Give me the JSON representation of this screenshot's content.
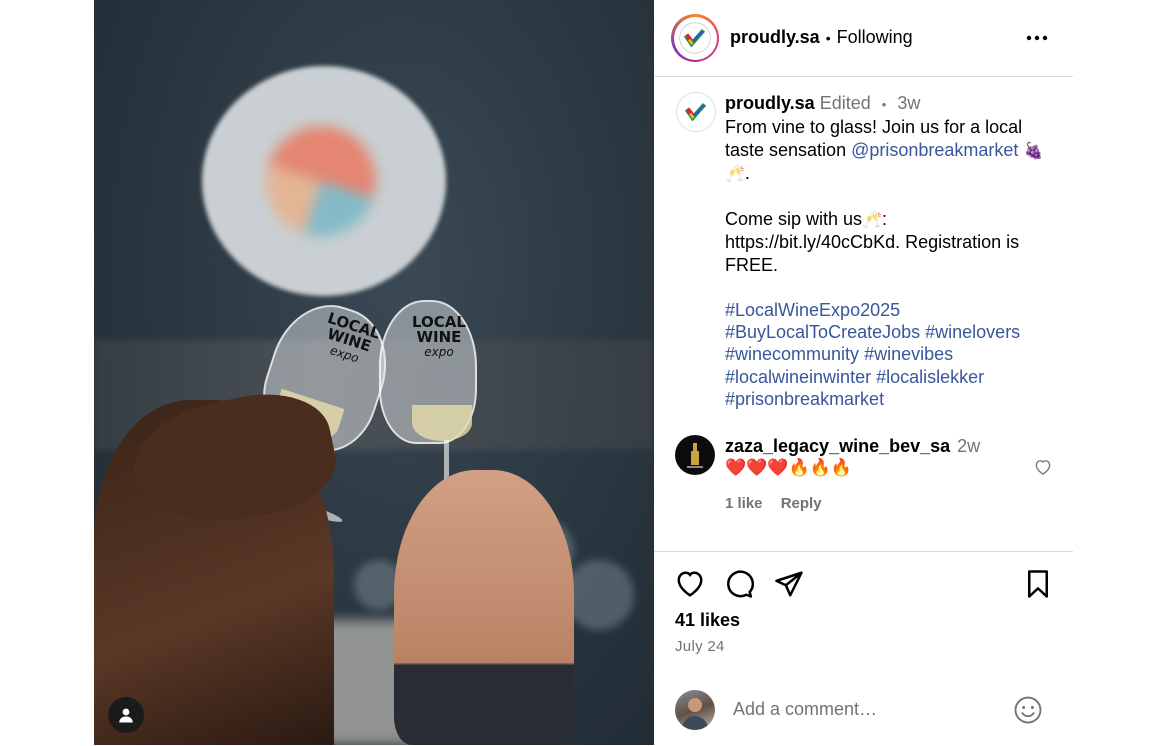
{
  "post_image": {
    "glass_text_left": [
      "LOCAL",
      "WINE",
      "expo"
    ],
    "glass_text_right": [
      "LOCAL",
      "WINE",
      "expo"
    ]
  },
  "header": {
    "username": "proudly.sa",
    "separator": "•",
    "follow_status": "Following",
    "more_icon": "more-horizontal-icon"
  },
  "caption": {
    "username": "proudly.sa",
    "edited": "Edited",
    "separator": "•",
    "time": "3w",
    "line1": "From vine to glass! Join us for a local taste sensation",
    "mention": "@prisonbreakmarket",
    "emoji1": "🍇",
    "emoji2": "🥂",
    "period": ".",
    "line2": "Come sip with us",
    "emoji3": "🥂",
    "line2_rest": ": https://bit.ly/40cCbKd. Registration is FREE.",
    "hashtags": [
      "#LocalWineExpo2025",
      "#BuyLocalToCreateJobs",
      "#winelovers",
      "#winecommunity",
      "#winevibes",
      "#localwineinwinter",
      "#localislekker",
      "#prisonbreakmarket"
    ]
  },
  "comment": {
    "username": "zaza_legacy_wine_bev_sa",
    "time": "2w",
    "text": "❤️❤️❤️🔥🔥🔥",
    "likes": "1 like",
    "reply": "Reply"
  },
  "actions": {
    "like_icon": "heart-icon",
    "comment_icon": "comment-icon",
    "share_icon": "send-icon",
    "save_icon": "bookmark-icon"
  },
  "likes": "41 likes",
  "date": "July 24",
  "add_comment": {
    "placeholder": "Add a comment…",
    "emoji_icon": "smile-icon"
  }
}
